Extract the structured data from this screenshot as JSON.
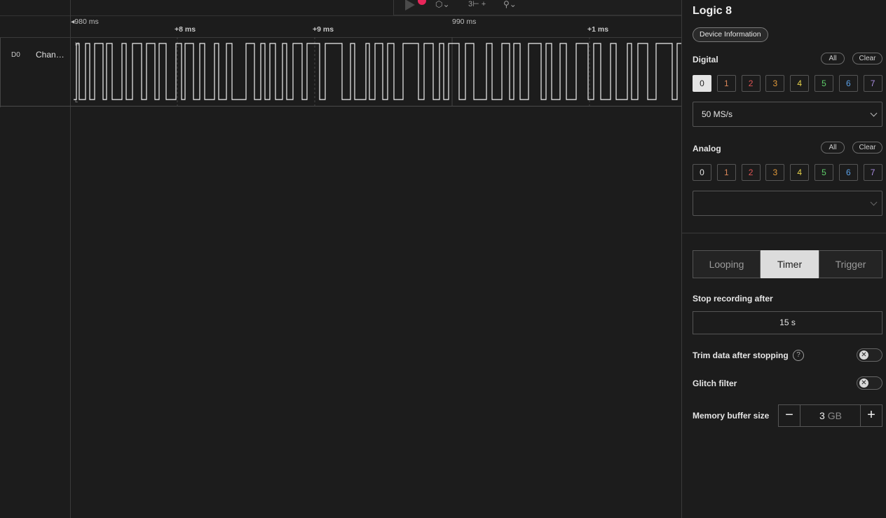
{
  "toolbar": {
    "play_icon": "play-icon",
    "record_indicator_color": "#e8265a",
    "icons": [
      "trigger-icon",
      "measure-icon",
      "marker-icon"
    ],
    "measure_badge": "3"
  },
  "timeline": {
    "ticks": [
      "980 ms",
      "+8 ms",
      "+9 ms",
      "990 ms",
      "+1 ms"
    ]
  },
  "channel": {
    "id": "D0",
    "name": "Chan…",
    "high_marker": "H",
    "low_marker": "L"
  },
  "device": {
    "title": "Logic 8",
    "info_button": "Device Information"
  },
  "digital": {
    "label": "Digital",
    "all": "All",
    "clear": "Clear",
    "channels": [
      "0",
      "1",
      "2",
      "3",
      "4",
      "5",
      "6",
      "7"
    ],
    "selected": "0",
    "rate": "50 MS/s"
  },
  "analog": {
    "label": "Analog",
    "all": "All",
    "clear": "Clear",
    "channels": [
      "0",
      "1",
      "2",
      "3",
      "4",
      "5",
      "6",
      "7"
    ],
    "rate": ""
  },
  "channel_colors": [
    "#e6e6e6",
    "#d9865a",
    "#e05555",
    "#e39a3a",
    "#e6d24a",
    "#5fcf6a",
    "#5aa0e6",
    "#a98be0"
  ],
  "mode": {
    "tabs": [
      "Looping",
      "Timer",
      "Trigger"
    ],
    "active": "Timer"
  },
  "settings": {
    "stop_label": "Stop recording after",
    "stop_value": "15 s",
    "trim_label": "Trim data after stopping",
    "trim_help": "?",
    "trim_enabled": false,
    "glitch_label": "Glitch filter",
    "glitch_enabled": false,
    "memory_label": "Memory buffer size",
    "memory_value": "3",
    "memory_unit": "GB",
    "minus": "−",
    "plus": "+"
  }
}
